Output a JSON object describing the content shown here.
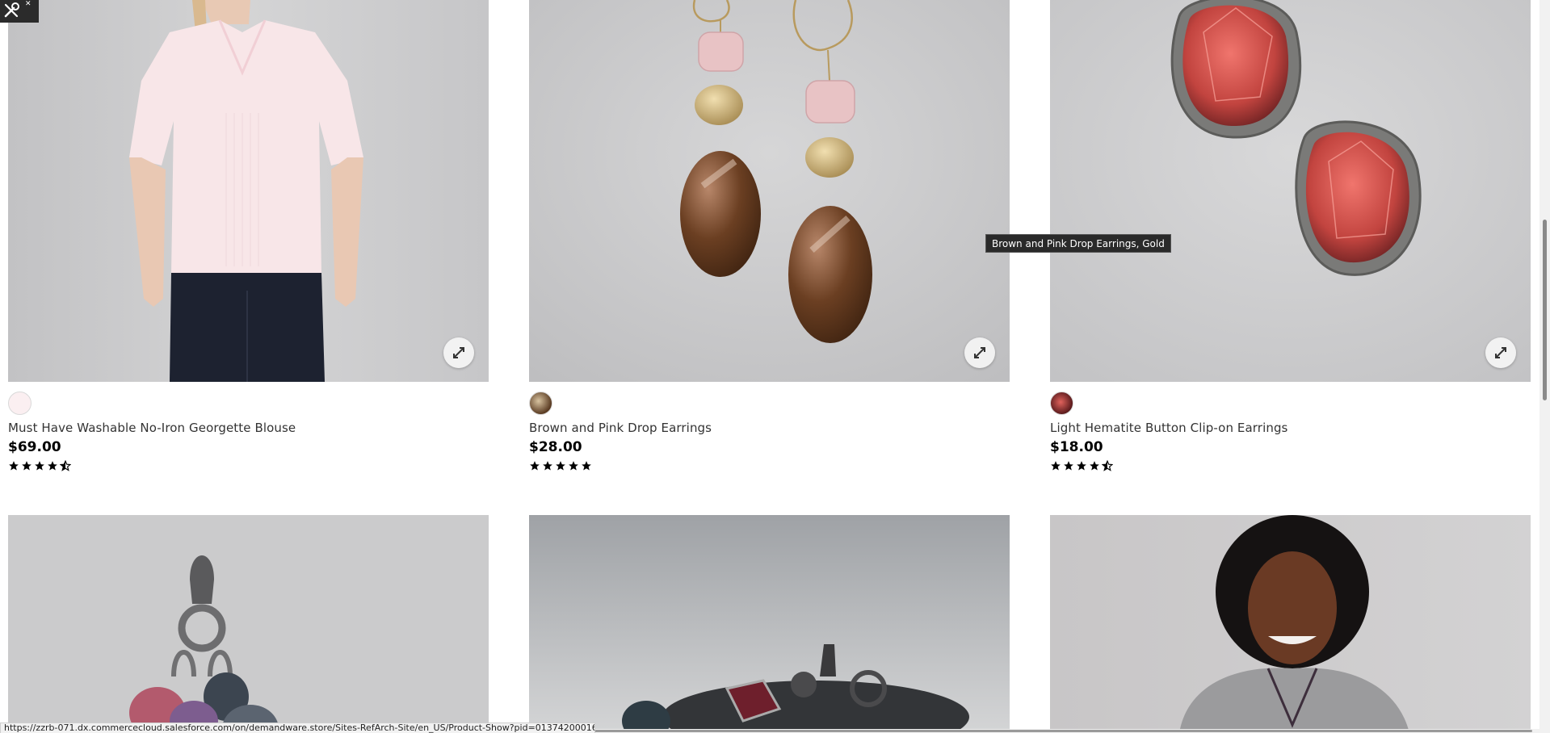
{
  "colors": {
    "price": "#000000",
    "tooltip_bg": "#2a2a2a",
    "image_bg": "#cfcfd0"
  },
  "dev_tool": {
    "icon": "wrench-screwdriver-icon",
    "close_icon": "close-icon"
  },
  "products": [
    {
      "name": "Must Have Washable No-Iron Georgette Blouse",
      "price": "$69.00",
      "rating": 4.5,
      "swatch_color": "#fbeff1",
      "image": "pink-blouse-model",
      "zoom_icon": "expand-arrows-icon"
    },
    {
      "name": "Brown and Pink Drop Earrings",
      "price": "$28.00",
      "rating": 5,
      "swatch_color": "#6b4a2f",
      "image": "brown-pink-drop-earrings",
      "zoom_icon": "expand-arrows-icon"
    },
    {
      "name": "Light Hematite Button Clip-on Earrings",
      "price": "$18.00",
      "rating": 4.5,
      "swatch_color": "#a8403e",
      "image": "hematite-clip-on-earrings",
      "zoom_icon": "expand-arrows-icon"
    }
  ],
  "row2": [
    {
      "image": "charm-pendant"
    },
    {
      "image": "charm-bracelet"
    },
    {
      "image": "woman-grey-sweater"
    }
  ],
  "tooltip": {
    "text": "Brown and Pink Drop Earrings, Gold"
  },
  "status_url": "https://zzrb-071.dx.commercecloud.salesforce.com/on/demandware.store/Sites-RefArch-Site/en_US/Product-Show?pid=013742000160M"
}
